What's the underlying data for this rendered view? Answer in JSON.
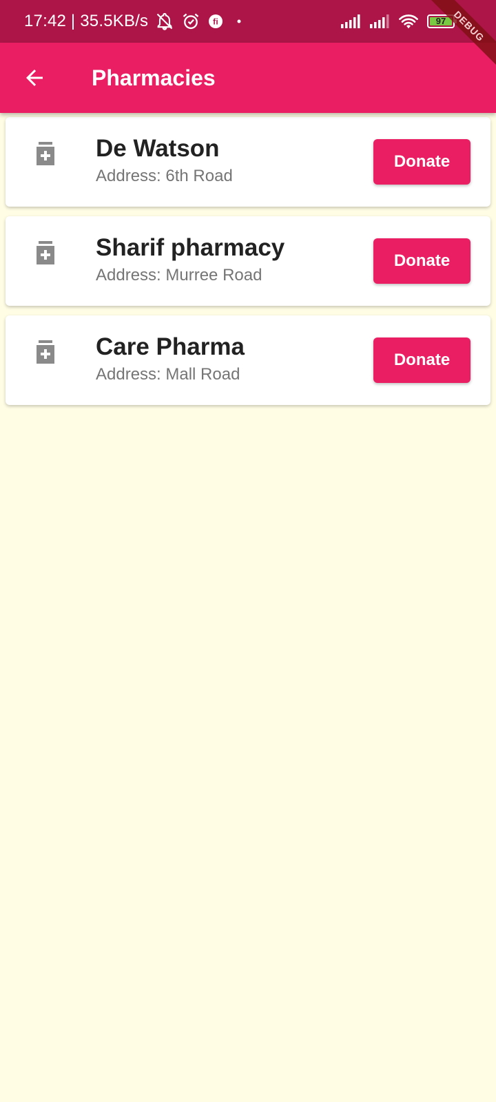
{
  "status_bar": {
    "time": "17:42",
    "network_speed": "35.5KB/s",
    "battery_level": "97",
    "left_icons": [
      "notifications-off-icon",
      "alarm-icon",
      "app-notification-icon",
      "dot-icon"
    ],
    "right_icons": [
      "signal-icon",
      "signal-icon",
      "wifi-icon",
      "battery-icon"
    ]
  },
  "debug_banner": "DEBUG",
  "app_bar": {
    "title": "Pharmacies",
    "back_icon": "arrow-back-icon"
  },
  "pharmacies": [
    {
      "name": "De Watson",
      "address": "Address: 6th Road",
      "action": "Donate"
    },
    {
      "name": "Sharif pharmacy",
      "address": "Address: Murree Road",
      "action": "Donate"
    },
    {
      "name": "Care Pharma",
      "address": "Address: Mall Road",
      "action": "Donate"
    }
  ],
  "colors": {
    "status_bar": "#AD1548",
    "primary": "#E91E63",
    "background": "#FFFDE4",
    "card": "#FFFFFF",
    "title_text": "#222222",
    "secondary_text": "#757575",
    "icon": "#8A8A8A",
    "battery_fill": "#7AC943"
  }
}
